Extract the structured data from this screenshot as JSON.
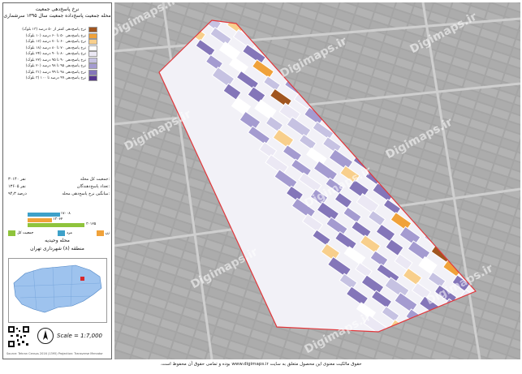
{
  "panel": {
    "title_line1": "نرخ پاسخ‌دهی جمعیت",
    "title_line2": "محله جمعیت پاسخ‌داده جمعیت سال ۱۳۹۵ سرشماری"
  },
  "legend": [
    {
      "label": "نرخ پاسخ‌دهی کمتر از ۵۰ درصد (۱۳ بلوک)",
      "color": "#a0551f"
    },
    {
      "label": "نرخ پاسخ‌دهی ۵۰ تا ۶۰ درصد (۱۰ بلوک)",
      "color": "#f0a23a"
    },
    {
      "label": "نرخ پاسخ‌دهی ۶۰ تا ۷۰ درصد (۱۶ بلوک)",
      "color": "#f8cf8c"
    },
    {
      "label": "نرخ پاسخ‌دهی ۷۰ تا ۸۰ درصد (۱۸ بلوک)",
      "color": "#ffffff"
    },
    {
      "label": "نرخ پاسخ‌دهی ۸۰ تا ۹۰ درصد (۲۴ بلوک)",
      "color": "#ebe8f4"
    },
    {
      "label": "نرخ پاسخ‌دهی ۹۰ تا ۹۵ درصد (۲۲ بلوک)",
      "color": "#c6c2e2"
    },
    {
      "label": "نرخ پاسخ‌دهی ۹۵ تا ۹۸ درصد (۲۰ بلوک)",
      "color": "#a49bd0"
    },
    {
      "label": "نرخ پاسخ‌دهی ۹۸ تا ۹۹ درصد (۳۱ بلوک)",
      "color": "#8476b9"
    },
    {
      "label": "نرخ پاسخ‌دهی ۹۹ درصد تا ۱۰۰ (۳ بلوک)",
      "color": "#55358e"
    }
  ],
  "stats": [
    {
      "label": "جمعیت کل محله:",
      "value": "۳۰۱۴۰ نفر"
    },
    {
      "label": "تعداد پاسخ‌دهندگان:",
      "value": "۱۳۶۰۵ نفر"
    },
    {
      "label": "میانگین نرخ پاسخ‌دهی محله:",
      "value": "۹۴٫۳ درصد"
    }
  ],
  "bars": [
    {
      "label": "۱۷۰۰۸",
      "value": 17008,
      "color": "#3ea1c9"
    },
    {
      "label": "۱۳۰۶۲",
      "value": 13062,
      "color": "#f0a23a"
    },
    {
      "label": "۳۰۱۲۵",
      "value": 30125,
      "color": "#8fc43c"
    }
  ],
  "categories": [
    {
      "label": "جمعیت کل",
      "color": "#8fc43c"
    },
    {
      "label": "مرد",
      "color": "#3ea1c9"
    },
    {
      "label": "زن",
      "color": "#f0a23a"
    }
  ],
  "neighborhood": {
    "title": "محله وحیدیه",
    "subtitle": "منطقه (۸) شهرداری تهران"
  },
  "scale": "Scale = 1:7,000",
  "copyright": "Source: Tehran Census 2016 (1395)  Projection: Transverse Mercator",
  "watermark": "Digimaps.ir",
  "footer": "حقوق مالکیت معنوی این محصول متعلق به سایت www.digimaps.ir بوده و تمامی حقوق آن محفوظ است."
}
